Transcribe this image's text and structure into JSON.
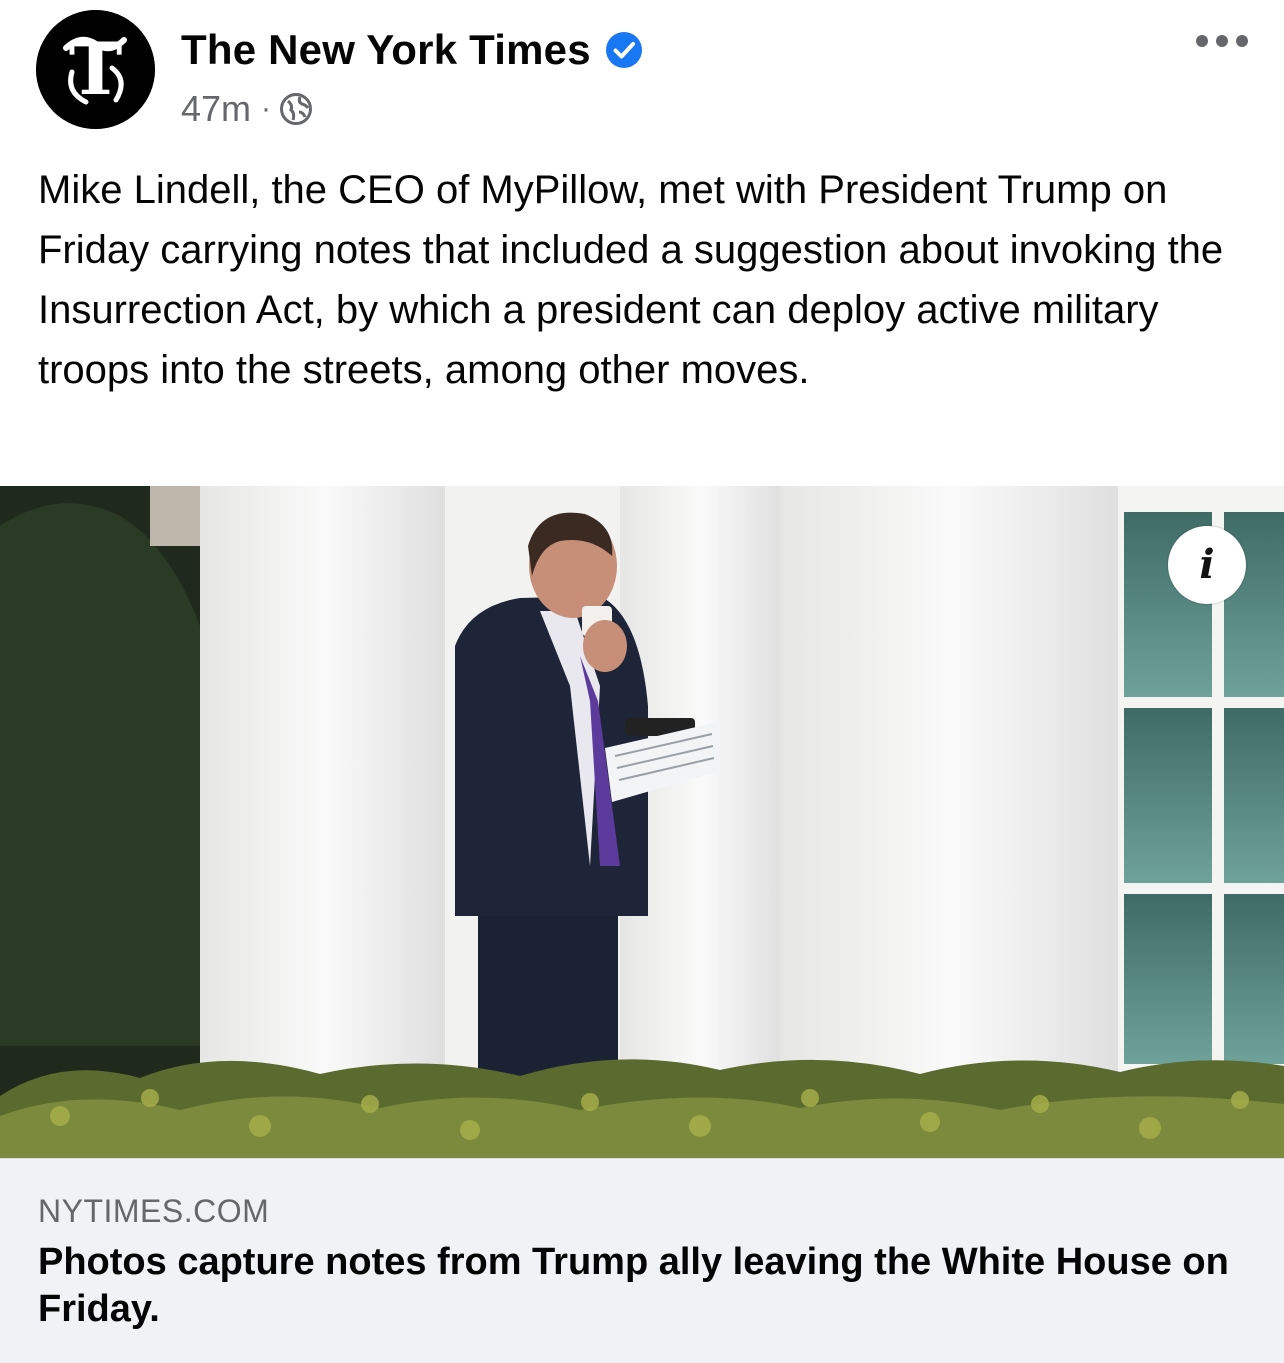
{
  "header": {
    "page_name": "The New York Times",
    "time": "47m",
    "separator": "·",
    "avatar_icon": "nyt-t-logo-icon",
    "verified_icon": "verified-badge-icon",
    "audience_icon": "globe-icon",
    "menu_icon": "more-options-icon",
    "verified_color": "#1877f2"
  },
  "post": {
    "text": "Mike Lindell, the CEO of MyPillow, met with President Trump on Friday carrying notes that included a suggestion about invoking the Insurrection Act, by which a president can deploy active military troops into the streets, among other moves."
  },
  "media": {
    "info_icon": "info-icon",
    "info_label": "i"
  },
  "link_preview": {
    "domain": "NYTIMES.COM",
    "title": "Photos capture notes from Trump ally leaving the White House on Friday."
  }
}
